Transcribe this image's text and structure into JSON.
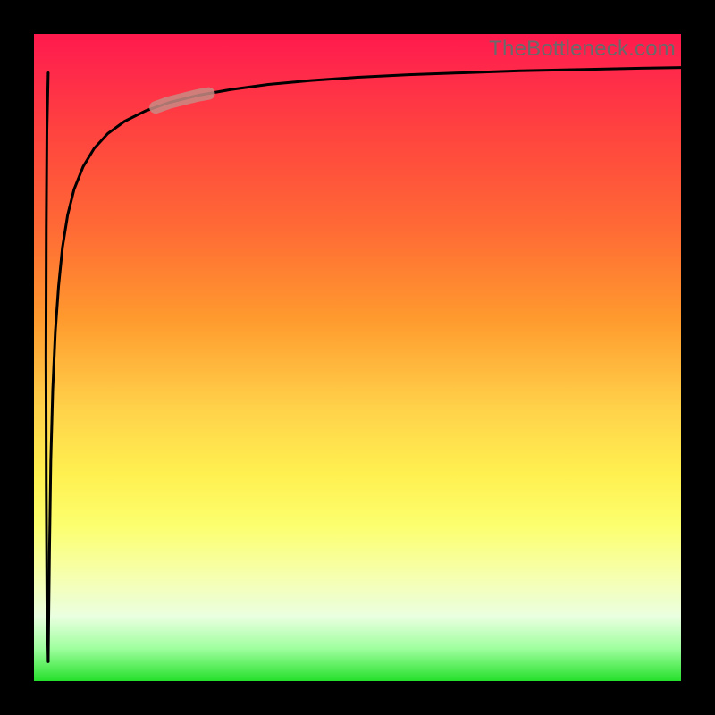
{
  "watermark": "TheBottleneck.com",
  "chart_data": {
    "type": "line",
    "title": "",
    "xlabel": "",
    "ylabel": "",
    "xlim": [
      0,
      100
    ],
    "ylim": [
      0,
      100
    ],
    "grid": false,
    "series": [
      {
        "name": "curve",
        "x": [
          2.2,
          2.4,
          2.6,
          2.9,
          3.3,
          3.8,
          4.4,
          5.2,
          6.2,
          7.6,
          9.3,
          11.4,
          14.0,
          17.2,
          20.9,
          25.3,
          30.4,
          36.2,
          42.8,
          50.0,
          57.9,
          66.3,
          75.1,
          84.4,
          93.8,
          100.0
        ],
        "y": [
          3.0,
          20.0,
          34.0,
          45.0,
          54.0,
          61.0,
          67.0,
          72.0,
          76.0,
          79.5,
          82.3,
          84.6,
          86.5,
          88.1,
          89.4,
          90.5,
          91.4,
          92.2,
          92.8,
          93.3,
          93.7,
          94.0,
          94.3,
          94.5,
          94.7,
          94.8
        ]
      },
      {
        "name": "left-edge",
        "x": [
          2.2,
          2.0,
          1.9,
          1.85,
          1.9,
          2.0,
          2.2
        ],
        "y": [
          3.0,
          12.0,
          30.0,
          50.0,
          70.0,
          85.0,
          94.0
        ]
      }
    ],
    "highlight_segment": {
      "series": "curve",
      "x_start": 18.8,
      "x_end": 27.0,
      "y_start": 88.4,
      "y_end": 90.8
    },
    "colors": {
      "curve": "#000000",
      "highlight": "#c98b84"
    }
  }
}
